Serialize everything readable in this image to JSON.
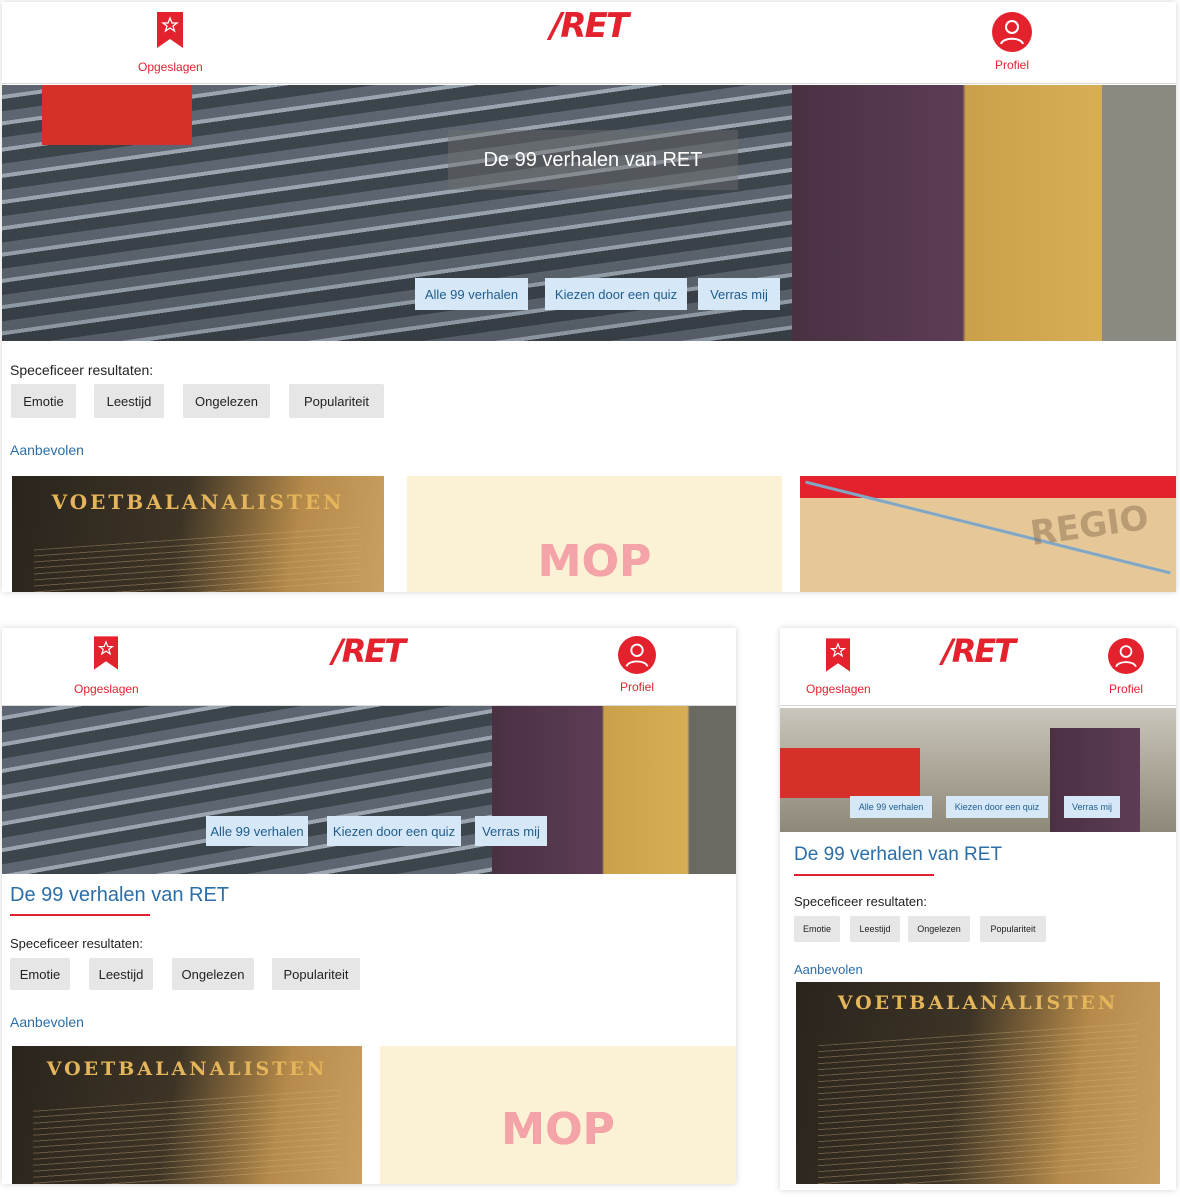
{
  "header": {
    "saved_label": "Opgeslagen",
    "profile_label": "Profiel",
    "logo_text": "/RET"
  },
  "hero": {
    "title": "De 99 verhalen van RET",
    "buttons": [
      "Alle 99 verhalen",
      "Kiezen door een quiz",
      "Verras mij"
    ]
  },
  "filters": {
    "label": "Speceficeer resultaten:",
    "items": [
      "Emotie",
      "Leestijd",
      "Ongelezen",
      "Populariteit"
    ]
  },
  "recommended": {
    "label": "Aanbevolen",
    "cards": [
      {
        "title": "VOETBALANALISTEN"
      },
      {
        "title": "MOP"
      },
      {
        "title": "REGIO"
      }
    ]
  },
  "colors": {
    "brand_red": "#e3222d",
    "link_blue": "#2b6ea8",
    "pill_bg": "#d6e8f7"
  },
  "icons": {
    "saved": "bookmark-star-icon",
    "profile": "user-circle-icon"
  }
}
